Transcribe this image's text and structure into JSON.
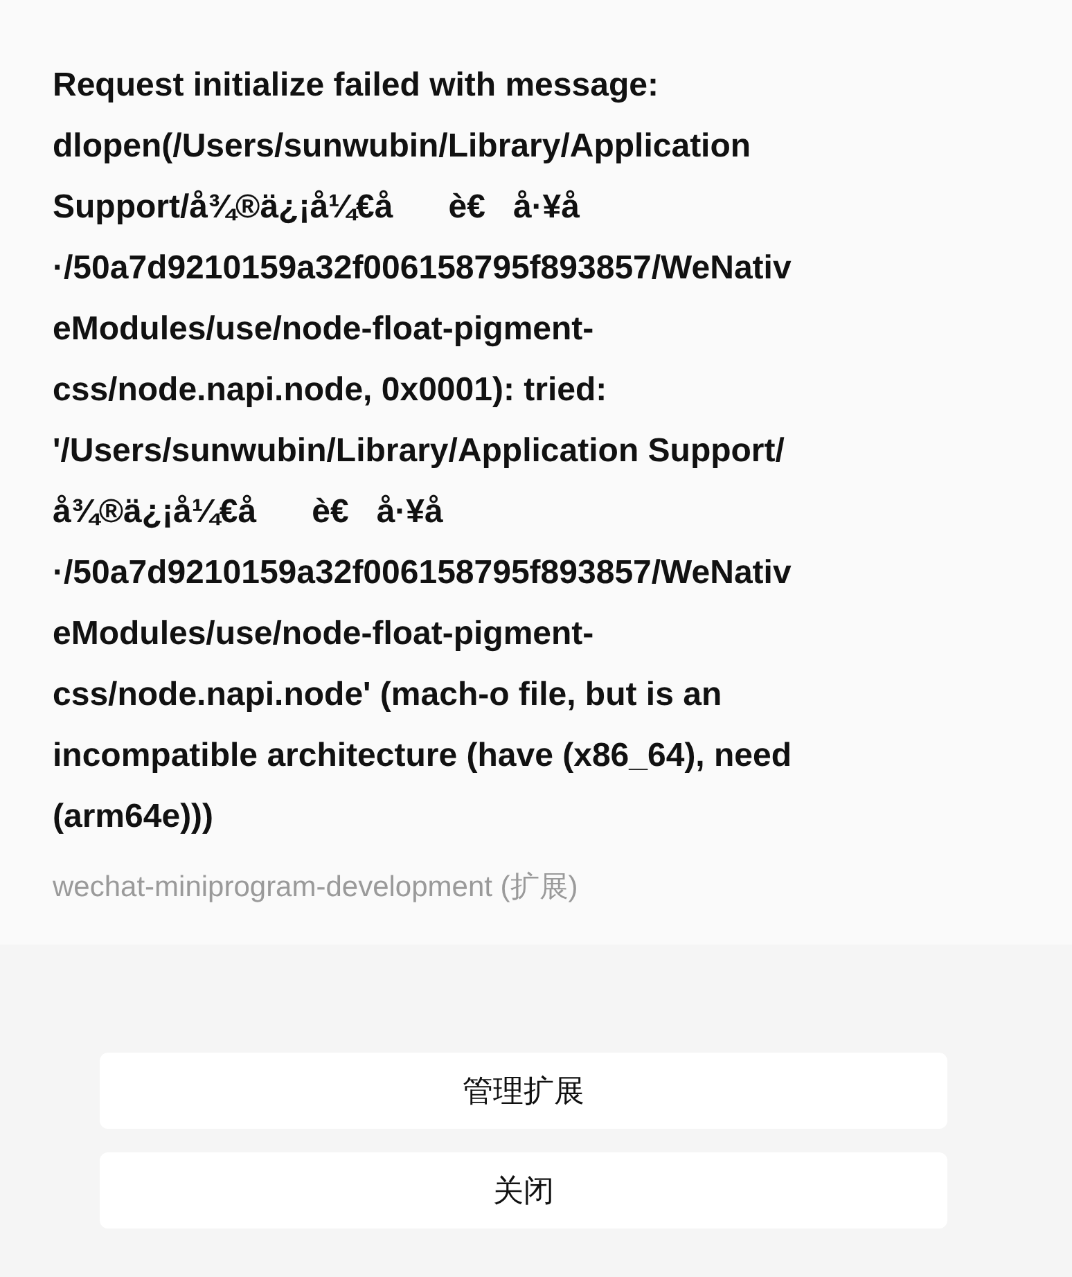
{
  "message": "Request initialize failed with message:\ndlopen(/Users/sunwubin/Library/Application\nSupport/å¾®ä¿¡å¼€å      è€   å·¥å\n·/50a7d9210159a32f006158795f893857/WeNativ\neModules/use/node-float-pigment-\ncss/node.napi.node, 0x0001): tried:\n'/Users/sunwubin/Library/Application Support/\nå¾®ä¿¡å¼€å      è€   å·¥å\n·/50a7d9210159a32f006158795f893857/WeNativ\neModules/use/node-float-pigment-\ncss/node.napi.node' (mach-o file, but is an\nincompatible architecture (have (x86_64), need\n(arm64e)))",
  "source": "wechat-miniprogram-development (扩展)",
  "buttons": [
    "管理扩展",
    "关闭"
  ]
}
